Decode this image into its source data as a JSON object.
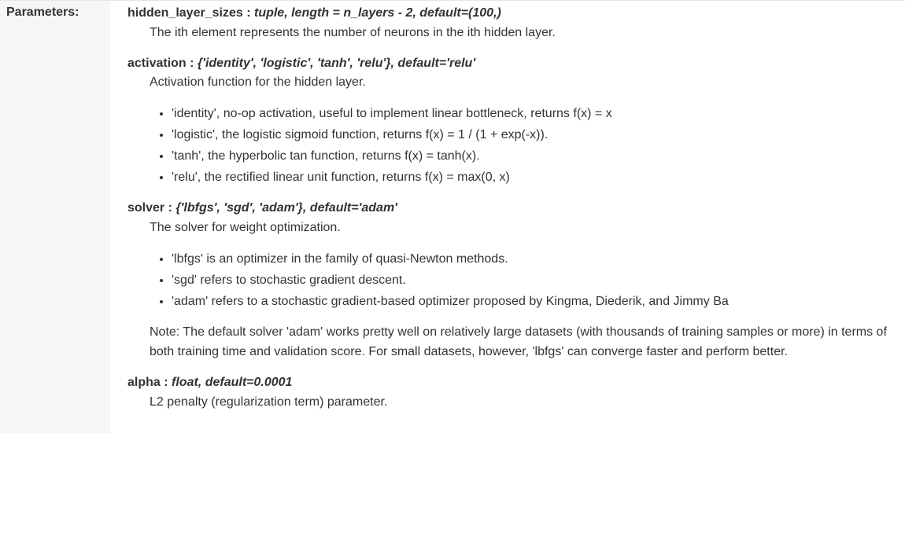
{
  "label": "Parameters:",
  "params": [
    {
      "name": "hidden_layer_sizes",
      "type": "tuple, length = n_layers - 2, default=(100,)",
      "desc": "The ith element represents the number of neurons in the ith hidden layer."
    },
    {
      "name": "activation",
      "type": "{'identity', 'logistic', 'tanh', 'relu'}, default='relu'",
      "desc": "Activation function for the hidden layer.",
      "options": [
        "'identity', no-op activation, useful to implement linear bottleneck, returns f(x) = x",
        "'logistic', the logistic sigmoid function, returns f(x) = 1 / (1 + exp(-x)).",
        "'tanh', the hyperbolic tan function, returns f(x) = tanh(x).",
        "'relu', the rectified linear unit function, returns f(x) = max(0, x)"
      ]
    },
    {
      "name": "solver",
      "type": "{'lbfgs', 'sgd', 'adam'}, default='adam'",
      "desc": "The solver for weight optimization.",
      "options": [
        "'lbfgs' is an optimizer in the family of quasi-Newton methods.",
        "'sgd' refers to stochastic gradient descent.",
        "'adam' refers to a stochastic gradient-based optimizer proposed by Kingma, Diederik, and Jimmy Ba"
      ],
      "note": "Note: The default solver 'adam' works pretty well on relatively large datasets (with thousands of training samples or more) in terms of both training time and validation score. For small datasets, however, 'lbfgs' can converge faster and perform better."
    },
    {
      "name": "alpha",
      "type": "float, default=0.0001",
      "desc": "L2 penalty (regularization term) parameter."
    }
  ]
}
